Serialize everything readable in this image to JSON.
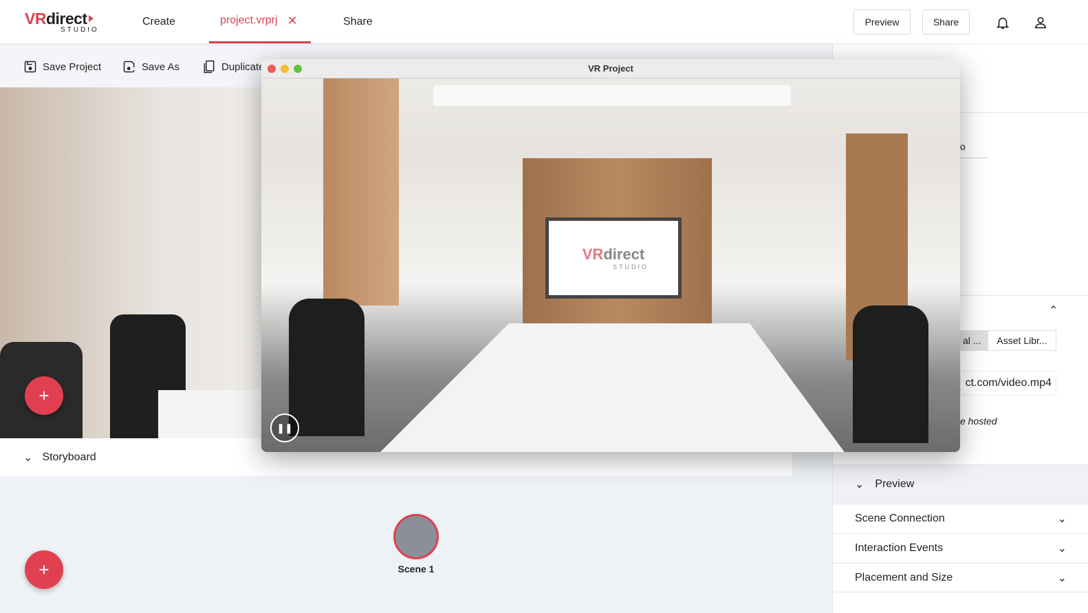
{
  "header": {
    "logo_main": "VRdirect",
    "logo_sub": "STUDIO",
    "nav": [
      "Create",
      "project.vrprj",
      "Share"
    ],
    "preview_btn": "Preview",
    "share_btn": "Share"
  },
  "toolbar": {
    "save": "Save Project",
    "save_as": "Save As",
    "duplicate": "Duplicate"
  },
  "window": {
    "title": "VR Project",
    "screen_logo_main": "VRdirect",
    "screen_logo_sub": "STUDIO"
  },
  "storyboard": {
    "label": "Storyboard",
    "scene": "Scene 1"
  },
  "panel": {
    "partial_field": "o",
    "tab_partial": "al ...",
    "tab_asset": "Asset Libr...",
    "url_partial": "ct.com/video.mp4",
    "hint_partial": "e hosted",
    "preview": "Preview",
    "sections": [
      "Scene Connection",
      "Interaction Events",
      "Placement and Size"
    ]
  },
  "colors": {
    "accent": "#d8414f"
  }
}
